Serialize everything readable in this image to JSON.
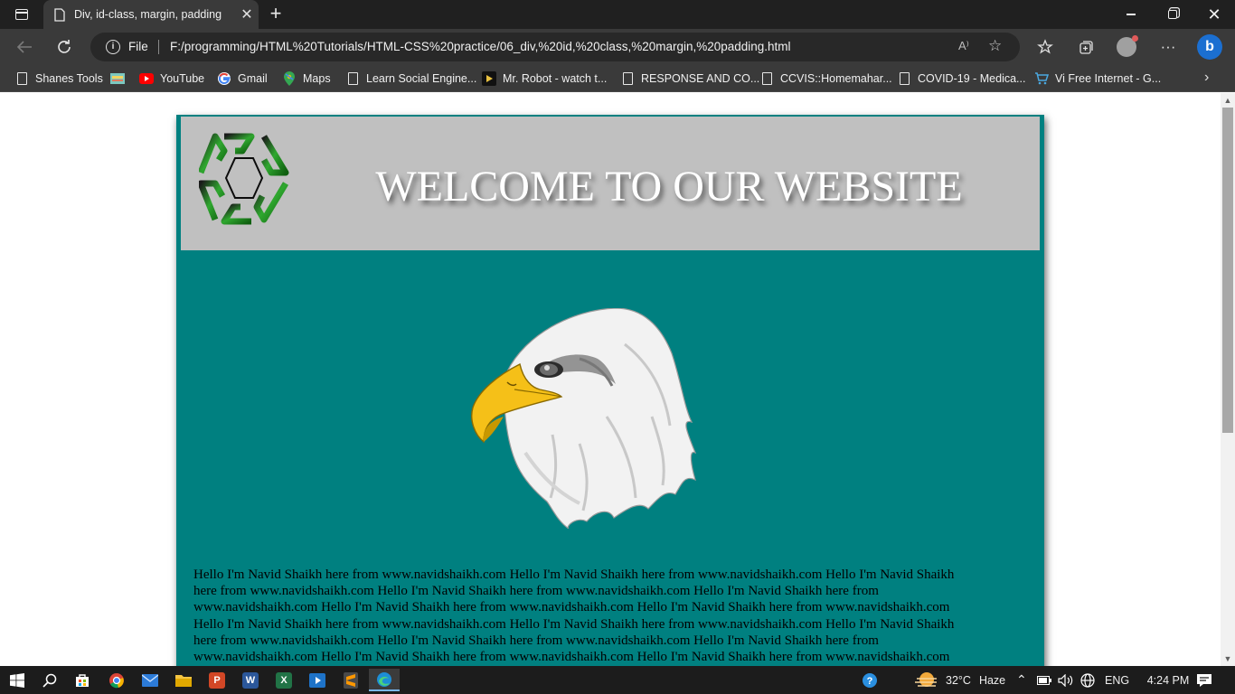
{
  "browser": {
    "tab_title": "Div, id-class, margin, padding",
    "address_scheme": "File",
    "address_url": "F:/programming/HTML%20Tutorials/HTML-CSS%20practice/06_div,%20id,%20class,%20margin,%20padding.html",
    "read_aloud": "A⁾",
    "bookmarks": [
      {
        "label": "Shanes Tools",
        "icon": "page-icon"
      },
      {
        "label": "",
        "icon": "colorful-app-icon"
      },
      {
        "label": "YouTube",
        "icon": "youtube-icon",
        "color": "#ff0000"
      },
      {
        "label": "Gmail",
        "icon": "google-icon"
      },
      {
        "label": "Maps",
        "icon": "maps-pin-icon"
      },
      {
        "label": "Learn Social Engine...",
        "icon": "page-icon"
      },
      {
        "label": "Mr. Robot - watch t...",
        "icon": "play-icon"
      },
      {
        "label": "RESPONSE AND CO...",
        "icon": "page-icon"
      },
      {
        "label": "CCVIS::Homemahar...",
        "icon": "page-icon"
      },
      {
        "label": "COVID-19 - Medica...",
        "icon": "page-icon"
      },
      {
        "label": "Vi Free Internet - G...",
        "icon": "cart-icon"
      }
    ]
  },
  "page": {
    "heading": "WELCOME TO OUR WEBSITE",
    "paragraph_lines": [
      "Hello I'm Navid Shaikh here from www.navidshaikh.com Hello I'm Navid Shaikh here from www.navidshaikh.com Hello I'm Navid Shaikh",
      "here from www.navidshaikh.com Hello I'm Navid Shaikh here from www.navidshaikh.com Hello I'm Navid Shaikh here from",
      "www.navidshaikh.com Hello I'm Navid Shaikh here from www.navidshaikh.com Hello I'm Navid Shaikh here from www.navidshaikh.com",
      "Hello I'm Navid Shaikh here from www.navidshaikh.com Hello I'm Navid Shaikh here from www.navidshaikh.com Hello I'm Navid Shaikh",
      "here from www.navidshaikh.com Hello I'm Navid Shaikh here from www.navidshaikh.com Hello I'm Navid Shaikh here from",
      "www.navidshaikh.com Hello I'm Navid Shaikh here from www.navidshaikh.com Hello I'm Navid Shaikh here from www.navidshaikh.com"
    ],
    "colors": {
      "container": "#008080",
      "header": "#c0c0c0",
      "heading": "#ffffff"
    }
  },
  "taskbar": {
    "weather_temp": "32°C",
    "weather_desc": "Haze",
    "language": "ENG",
    "time": "4:24 PM"
  }
}
